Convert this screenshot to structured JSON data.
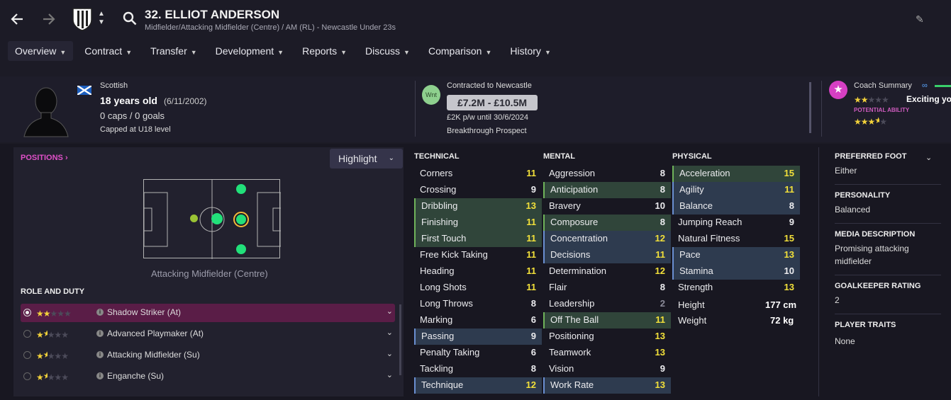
{
  "header": {
    "title": "32. ELLIOT ANDERSON",
    "subtitle": "Midfielder/Attacking Midfielder (Centre) / AM (RL) - Newcastle Under 23s"
  },
  "menu": [
    {
      "label": "Overview",
      "active": true
    },
    {
      "label": "Contract"
    },
    {
      "label": "Transfer"
    },
    {
      "label": "Development"
    },
    {
      "label": "Reports"
    },
    {
      "label": "Discuss"
    },
    {
      "label": "Comparison"
    },
    {
      "label": "History"
    }
  ],
  "profile": {
    "nationality": "Scottish",
    "age": "18 years old",
    "dob": "(6/11/2002)",
    "caps": "0 caps / 0 goals",
    "capped": "Capped at U18 level"
  },
  "contract": {
    "badge": "Wnt",
    "status": "Contracted to Newcastle",
    "value": "£7.2M - £10.5M",
    "wage": "£2K p/w until 30/6/2024",
    "prospect": "Breakthrough Prospect"
  },
  "coach": {
    "label": "Coach Summary",
    "headline": "Exciting yo",
    "potential_label": "POTENTIAL ABILITY",
    "current_stars": 2,
    "potential_stars": 3.5
  },
  "positions": {
    "link": "POSITIONS",
    "highlight_button": "Highlight",
    "pitch_label": "Attacking Midfielder (Centre)"
  },
  "roles": {
    "heading": "ROLE AND DUTY",
    "items": [
      {
        "name": "Shadow Striker (At)",
        "stars": 2,
        "selected": true
      },
      {
        "name": "Advanced Playmaker (At)",
        "stars": 1.5
      },
      {
        "name": "Attacking Midfielder (Su)",
        "stars": 1.5
      },
      {
        "name": "Enganche (Su)",
        "stars": 1.5
      }
    ]
  },
  "technical": {
    "heading": "TECHNICAL",
    "rows": [
      {
        "name": "Corners",
        "value": "11",
        "hl": ""
      },
      {
        "name": "Crossing",
        "value": "9",
        "hl": ""
      },
      {
        "name": "Dribbling",
        "value": "13",
        "hl": "g"
      },
      {
        "name": "Finishing",
        "value": "11",
        "hl": "g"
      },
      {
        "name": "First Touch",
        "value": "11",
        "hl": "g"
      },
      {
        "name": "Free Kick Taking",
        "value": "11",
        "hl": ""
      },
      {
        "name": "Heading",
        "value": "11",
        "hl": ""
      },
      {
        "name": "Long Shots",
        "value": "11",
        "hl": ""
      },
      {
        "name": "Long Throws",
        "value": "8",
        "hl": ""
      },
      {
        "name": "Marking",
        "value": "6",
        "hl": ""
      },
      {
        "name": "Passing",
        "value": "9",
        "hl": "b"
      },
      {
        "name": "Penalty Taking",
        "value": "6",
        "hl": ""
      },
      {
        "name": "Tackling",
        "value": "8",
        "hl": ""
      },
      {
        "name": "Technique",
        "value": "12",
        "hl": "b"
      }
    ]
  },
  "mental": {
    "heading": "MENTAL",
    "rows": [
      {
        "name": "Aggression",
        "value": "8",
        "hl": ""
      },
      {
        "name": "Anticipation",
        "value": "8",
        "hl": "g"
      },
      {
        "name": "Bravery",
        "value": "10",
        "hl": ""
      },
      {
        "name": "Composure",
        "value": "8",
        "hl": "g"
      },
      {
        "name": "Concentration",
        "value": "12",
        "hl": "b"
      },
      {
        "name": "Decisions",
        "value": "11",
        "hl": "b"
      },
      {
        "name": "Determination",
        "value": "12",
        "hl": ""
      },
      {
        "name": "Flair",
        "value": "8",
        "hl": ""
      },
      {
        "name": "Leadership",
        "value": "2",
        "hl": ""
      },
      {
        "name": "Off The Ball",
        "value": "11",
        "hl": "g"
      },
      {
        "name": "Positioning",
        "value": "13",
        "hl": ""
      },
      {
        "name": "Teamwork",
        "value": "13",
        "hl": ""
      },
      {
        "name": "Vision",
        "value": "9",
        "hl": ""
      },
      {
        "name": "Work Rate",
        "value": "13",
        "hl": "b"
      }
    ]
  },
  "physical": {
    "heading": "PHYSICAL",
    "rows": [
      {
        "name": "Acceleration",
        "value": "15",
        "hl": "g"
      },
      {
        "name": "Agility",
        "value": "11",
        "hl": "b"
      },
      {
        "name": "Balance",
        "value": "8",
        "hl": "b"
      },
      {
        "name": "Jumping Reach",
        "value": "9",
        "hl": ""
      },
      {
        "name": "Natural Fitness",
        "value": "15",
        "hl": ""
      },
      {
        "name": "Pace",
        "value": "13",
        "hl": "b"
      },
      {
        "name": "Stamina",
        "value": "10",
        "hl": "b"
      },
      {
        "name": "Strength",
        "value": "13",
        "hl": ""
      }
    ],
    "height_label": "Height",
    "height": "177 cm",
    "weight_label": "Weight",
    "weight": "72 kg"
  },
  "info": {
    "foot_label": "PREFERRED FOOT",
    "foot": "Either",
    "personality_label": "PERSONALITY",
    "personality": "Balanced",
    "media_label": "MEDIA DESCRIPTION",
    "media": "Promising attacking midfielder",
    "gk_label": "GOALKEEPER RATING",
    "gk": "2",
    "traits_label": "PLAYER TRAITS",
    "traits": "None"
  },
  "colors": {
    "highlight_value": "#f2e03a",
    "green_row": "#30453a",
    "blue_row": "#2e3b4f",
    "selected_role": "#5a1d47",
    "accent": "#e050c8"
  }
}
